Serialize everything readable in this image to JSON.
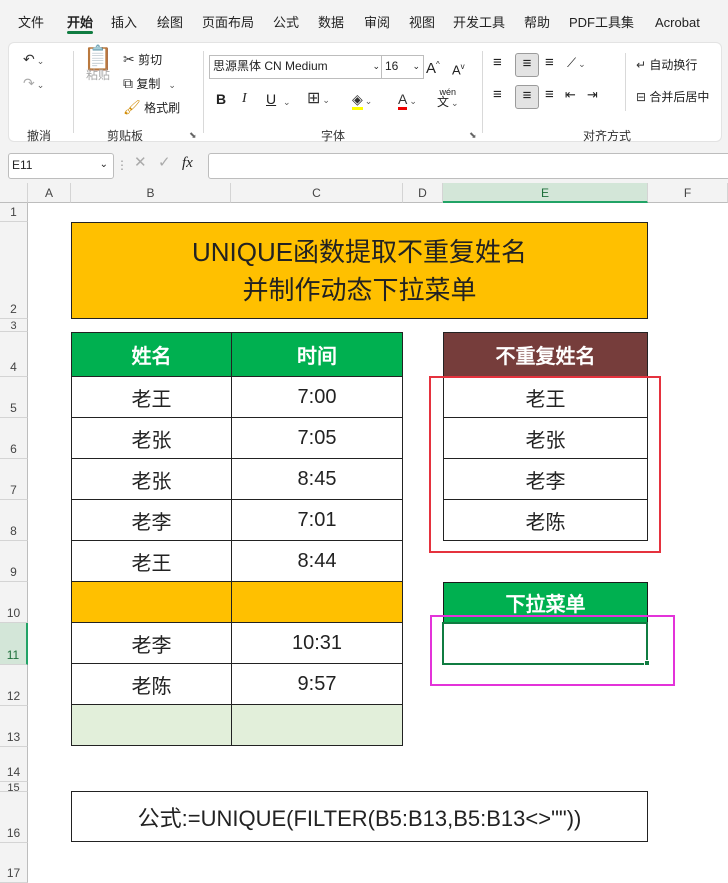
{
  "menu": {
    "tabs": [
      "文件",
      "开始",
      "插入",
      "绘图",
      "页面布局",
      "公式",
      "数据",
      "审阅",
      "视图",
      "开发工具",
      "帮助",
      "PDF工具集",
      "Acrobat"
    ],
    "active": "开始"
  },
  "ribbon": {
    "undo_group": "撤消",
    "clipboard": {
      "paste": "粘贴",
      "cut": "剪切",
      "copy": "复制",
      "format_painter": "格式刷",
      "group": "剪贴板"
    },
    "font": {
      "name": "思源黑体 CN Medium",
      "size": "16",
      "group": "字体",
      "grow": "A",
      "shrink": "A",
      "bold": "B",
      "italic": "I",
      "underline": "U",
      "wen": "wén",
      "wen2": "文"
    },
    "alignment": {
      "wrap": "自动换行",
      "merge": "合并后居中",
      "group": "对齐方式"
    }
  },
  "formula_bar": {
    "name_box": "E11",
    "fx": "fx",
    "content": ""
  },
  "columns": [
    "A",
    "B",
    "C",
    "D",
    "E",
    "F"
  ],
  "rows": [
    "1",
    "2",
    "3",
    "4",
    "5",
    "6",
    "7",
    "8",
    "9",
    "10",
    "11",
    "12",
    "13",
    "14",
    "15",
    "16",
    "17"
  ],
  "sheet": {
    "title_line1": "UNIQUE函数提取不重复姓名",
    "title_line2": "并制作动态下拉菜单",
    "table": {
      "headers": [
        "姓名",
        "时间"
      ],
      "rows": [
        [
          "老王",
          "7:00"
        ],
        [
          "老张",
          "7:05"
        ],
        [
          "老张",
          "8:45"
        ],
        [
          "老李",
          "7:01"
        ],
        [
          "老王",
          "8:44"
        ],
        [
          "",
          ""
        ],
        [
          "老李",
          "10:31"
        ],
        [
          "老陈",
          "9:57"
        ],
        [
          "",
          ""
        ]
      ]
    },
    "unique": {
      "header": "不重复姓名",
      "items": [
        "老王",
        "老张",
        "老李",
        "老陈"
      ]
    },
    "dropdown": {
      "header": "下拉菜单",
      "value": ""
    },
    "formula_note": "公式:=UNIQUE(FILTER(B5:B13,B5:B13<>\"\"))"
  },
  "colors": {
    "title_bg": "#ffc000",
    "table_header": "#00b050",
    "unique_header": "#763d3b",
    "dropdown_header": "#00b050",
    "highlight_row": "#ffc000",
    "empty_row": "#e2efda",
    "red_box": "#e5323e",
    "magenta_box": "#e333d9"
  }
}
